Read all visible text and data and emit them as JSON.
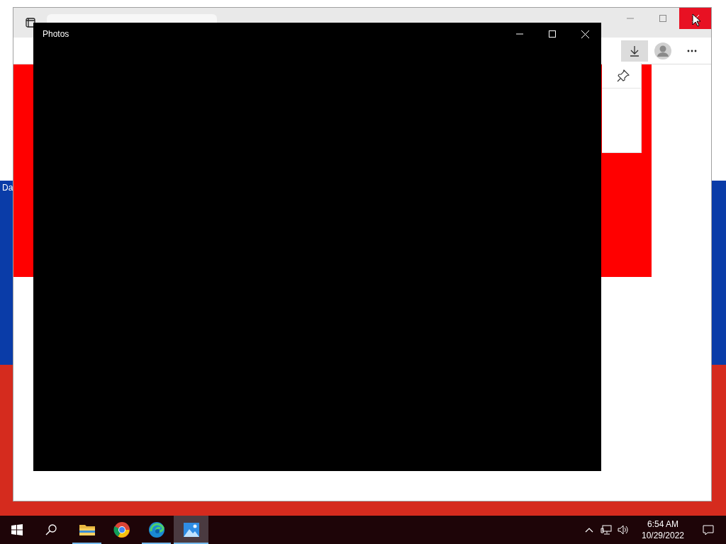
{
  "desktop": {
    "icon_label": "Da"
  },
  "browser": {
    "close_hovered": true,
    "download_active": true
  },
  "photos": {
    "title": "Photos"
  },
  "taskbar": {
    "apps": [
      {
        "kind": "explorer",
        "running": true,
        "selected": false
      },
      {
        "kind": "chrome",
        "running": false,
        "selected": false
      },
      {
        "kind": "edge",
        "running": true,
        "selected": false
      },
      {
        "kind": "photos",
        "running": true,
        "selected": true
      }
    ],
    "time": "6:54 AM",
    "date": "10/29/2022"
  }
}
